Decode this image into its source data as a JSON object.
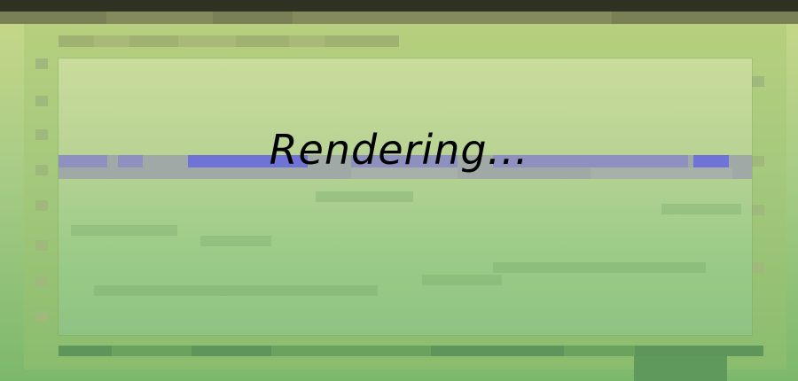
{
  "window": {
    "status_text": "Rendering..."
  },
  "colors": {
    "background_top": "#c8d888",
    "background_bottom": "#7cb86c",
    "title_bar": "#2f3222",
    "accent_blue": "#6f73d6",
    "text": "#000000"
  }
}
